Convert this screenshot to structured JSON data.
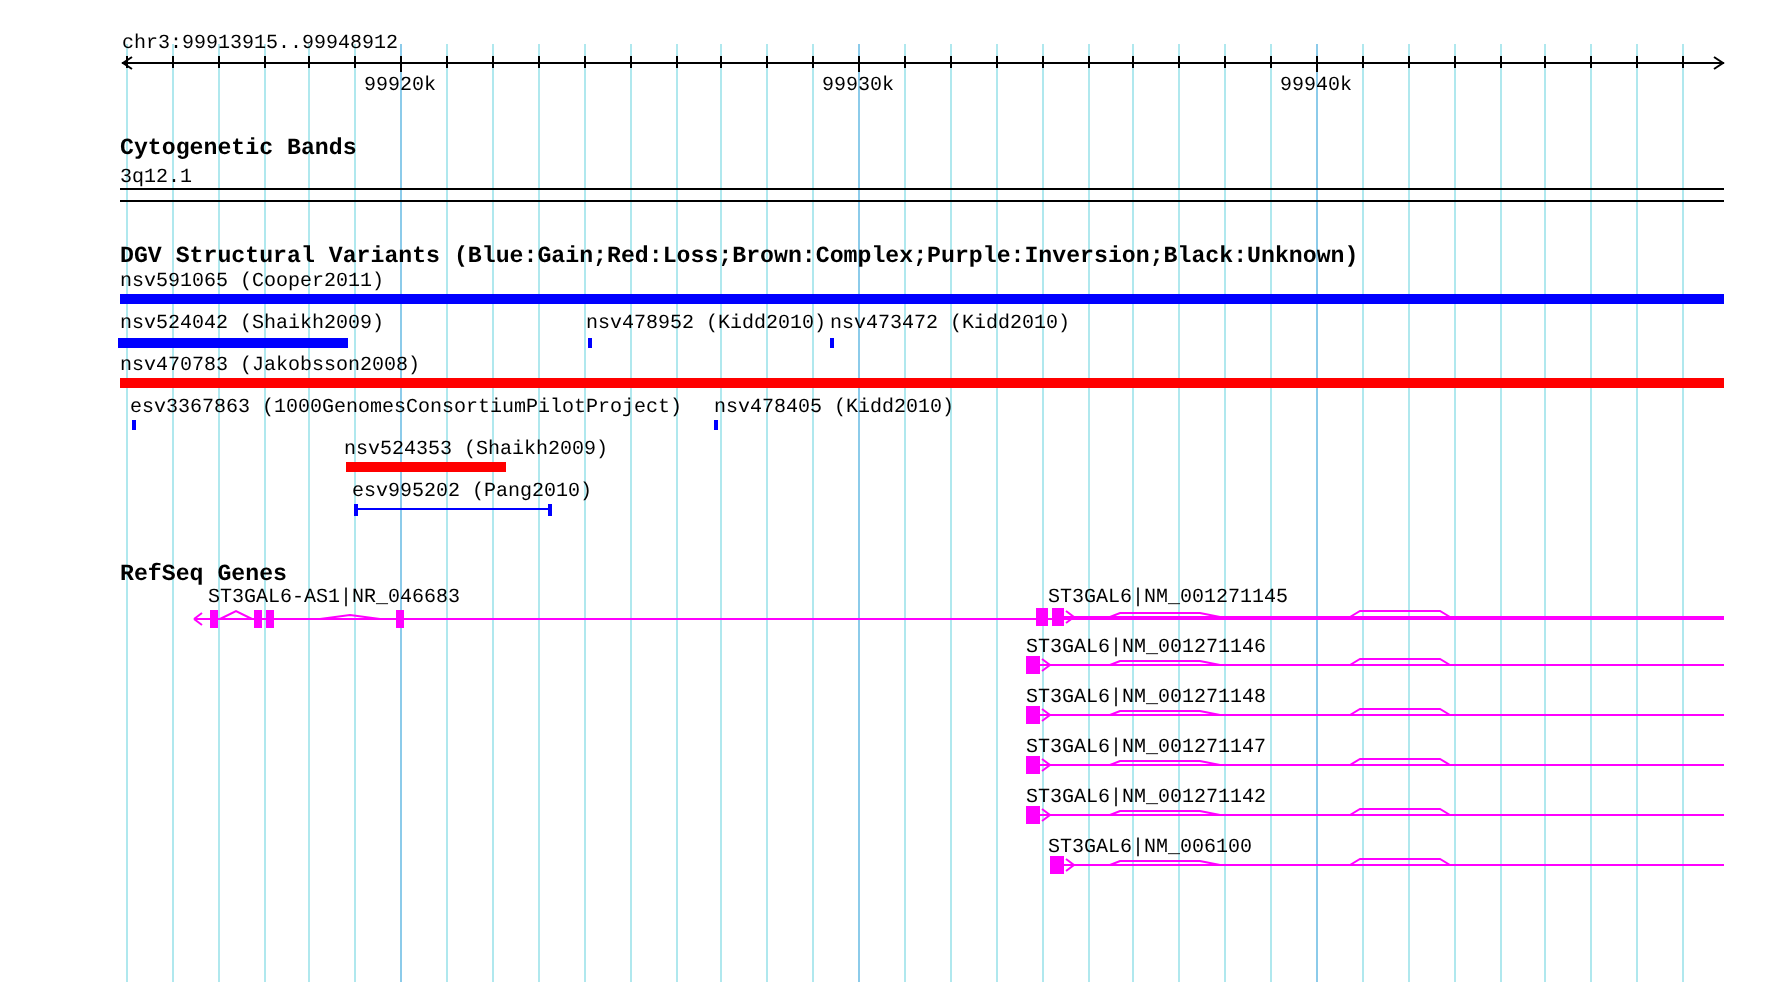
{
  "ruler": {
    "range": "chr3:99913915..99948912",
    "ticks": [
      "99920k",
      "99930k",
      "99940k"
    ]
  },
  "tracks": [
    {
      "title": "Cytogenetic Bands",
      "features": [
        {
          "kind": "band",
          "label": "3q12.1"
        }
      ]
    },
    {
      "title": "DGV Structural Variants (Blue:Gain;Red:Loss;Brown:Complex;Purple:Inversion;Black:Unknown)",
      "features": [
        {
          "kind": "bar",
          "label": "nsv591065 (Cooper2011)",
          "color": "#0000ff"
        },
        {
          "kind": "bar",
          "label": "nsv524042 (Shaikh2009)",
          "color": "#0000ff"
        },
        {
          "kind": "bar",
          "label": "nsv478952 (Kidd2010)",
          "color": "#0000ff"
        },
        {
          "kind": "bar",
          "label": "nsv473472 (Kidd2010)",
          "color": "#0000ff"
        },
        {
          "kind": "bar",
          "label": "nsv470783 (Jakobsson2008)",
          "color": "#ff0000"
        },
        {
          "kind": "bar",
          "label": "esv3367863 (1000GenomesConsortiumPilotProject)",
          "color": "#0000ff"
        },
        {
          "kind": "bar",
          "label": "nsv478405 (Kidd2010)",
          "color": "#0000ff"
        },
        {
          "kind": "bar",
          "label": "nsv524353 (Shaikh2009)",
          "color": "#ff0000"
        },
        {
          "kind": "span",
          "label": "esv995202 (Pang2010)",
          "color": "#0000ff"
        }
      ]
    },
    {
      "title": "RefSeq Genes",
      "features": [
        {
          "kind": "transcript",
          "label": "ST3GAL6-AS1|NR_046683",
          "reverse": true
        },
        {
          "kind": "transcript",
          "label": "ST3GAL6|NM_001271145",
          "reverse": false
        },
        {
          "kind": "transcript",
          "label": "ST3GAL6|NM_001271146",
          "reverse": false
        },
        {
          "kind": "transcript",
          "label": "ST3GAL6|NM_001271148",
          "reverse": false
        },
        {
          "kind": "transcript",
          "label": "ST3GAL6|NM_001271147",
          "reverse": false
        },
        {
          "kind": "transcript",
          "label": "ST3GAL6|NM_001271142",
          "reverse": false
        },
        {
          "kind": "transcript",
          "label": "ST3GAL6|NM_006100",
          "reverse": false
        }
      ]
    }
  ]
}
